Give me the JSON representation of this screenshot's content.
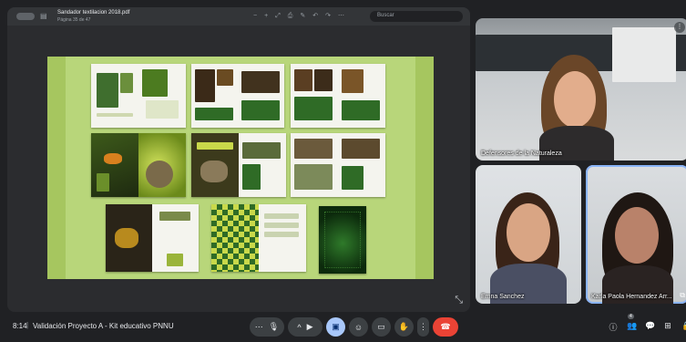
{
  "pdf_viewer": {
    "document_title": "Sandador textilacion 2018.pdf",
    "page_info": "Página 35 de 47",
    "search_placeholder": "Buscar",
    "toolbar_icons": [
      "sidebar-icon",
      "zoom-out-icon",
      "zoom-in-icon",
      "fit-icon",
      "pen-icon",
      "undo-icon",
      "redo-icon",
      "more-icon"
    ]
  },
  "participants": {
    "main": {
      "name": "Defensores de la Naturaleza"
    },
    "bottom_left": {
      "name": "Emna Sanchez"
    },
    "bottom_right": {
      "name": "Karla Paola Hernandez Arr..."
    }
  },
  "meeting": {
    "time": "8:14",
    "separator": "|",
    "title": "Validación Proyecto A - Kit educativo PNNU",
    "participant_count": "4"
  },
  "controls": {
    "more_options": "⋯",
    "mic": "🎙",
    "chevron": "^",
    "camera": "▶",
    "present": "▣",
    "emoji": "☺",
    "captions": "▭",
    "raise_hand": "✋",
    "overflow": "⋮",
    "hangup": "☎"
  },
  "right_icons": {
    "info": "ⓘ",
    "people": "👥",
    "chat": "💬",
    "activities": "⊞",
    "lock": "🔒"
  },
  "colors": {
    "background": "#202124",
    "accent": "#a8c7fa",
    "hangup": "#ea4335",
    "canvas_green": "#b8d67a"
  }
}
